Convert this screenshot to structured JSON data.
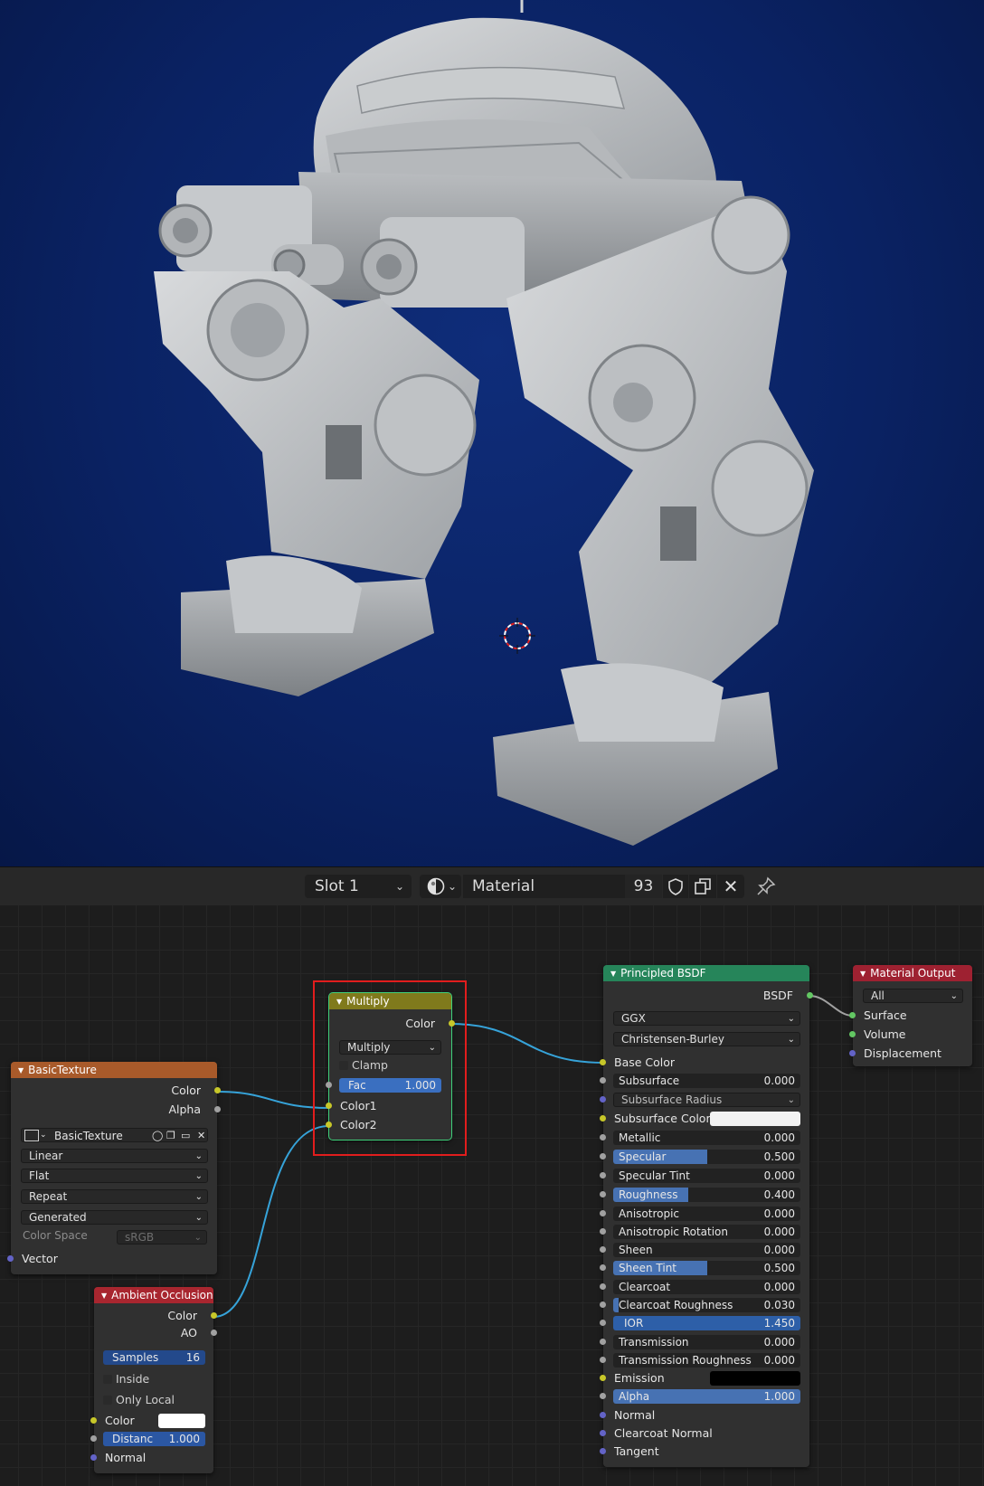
{
  "header": {
    "slot_label": "Slot 1",
    "material_name": "Material",
    "user_count": "93",
    "icons": [
      "sphere-shading-icon",
      "fake-user-shield-icon",
      "duplicate-icon",
      "close-icon",
      "pin-icon"
    ]
  },
  "nodes": {
    "basic_texture": {
      "title": "BasicTexture",
      "outputs": [
        "Color",
        "Alpha"
      ],
      "image_name": "BasicTexture",
      "interpolation": "Linear",
      "projection": "Flat",
      "extension": "Repeat",
      "source": "Generated",
      "color_space_label": "Color Space",
      "color_space_value": "sRGB",
      "input": "Vector"
    },
    "ambient_occlusion": {
      "title": "Ambient Occlusion",
      "outputs": [
        "Color",
        "AO"
      ],
      "samples_label": "Samples",
      "samples_value": "16",
      "inside_label": "Inside",
      "only_local_label": "Only Local",
      "color_label": "Color",
      "distance_label": "Distanc",
      "distance_value": "1.000",
      "normal_label": "Normal"
    },
    "multiply": {
      "title": "Multiply",
      "output": "Color",
      "blend_mode": "Multiply",
      "clamp_label": "Clamp",
      "fac_label": "Fac",
      "fac_value": "1.000",
      "input1": "Color1",
      "input2": "Color2"
    },
    "principled": {
      "title": "Principled BSDF",
      "output": "BSDF",
      "distribution": "GGX",
      "subsurface_method": "Christensen-Burley",
      "base_color_label": "Base Color",
      "subsurface_label": "Subsurface",
      "subsurface_value": "0.000",
      "subsurface_radius_label": "Subsurface Radius",
      "subsurface_color_label": "Subsurface Color",
      "metallic_label": "Metallic",
      "metallic_value": "0.000",
      "specular_label": "Specular",
      "specular_value": "0.500",
      "specular_fill": 0.5,
      "specular_tint_label": "Specular Tint",
      "specular_tint_value": "0.000",
      "roughness_label": "Roughness",
      "roughness_value": "0.400",
      "roughness_fill": 0.4,
      "anisotropic_label": "Anisotropic",
      "anisotropic_value": "0.000",
      "anisotropic_rotation_label": "Anisotropic Rotation",
      "anisotropic_rotation_value": "0.000",
      "sheen_label": "Sheen",
      "sheen_value": "0.000",
      "sheen_tint_label": "Sheen Tint",
      "sheen_tint_value": "0.500",
      "sheen_tint_fill": 0.5,
      "clearcoat_label": "Clearcoat",
      "clearcoat_value": "0.000",
      "clearcoat_roughness_label": "Clearcoat Roughness",
      "clearcoat_roughness_value": "0.030",
      "clearcoat_roughness_fill": 0.03,
      "ior_label": "IOR",
      "ior_value": "1.450",
      "transmission_label": "Transmission",
      "transmission_value": "0.000",
      "transmission_roughness_label": "Transmission Roughness",
      "transmission_roughness_value": "0.000",
      "emission_label": "Emission",
      "alpha_label": "Alpha",
      "alpha_value": "1.000",
      "alpha_fill": 1.0,
      "normal_label": "Normal",
      "clearcoat_normal_label": "Clearcoat Normal",
      "tangent_label": "Tangent"
    },
    "material_output": {
      "title": "Material Output",
      "target": "All",
      "inputs": [
        "Surface",
        "Volume",
        "Displacement"
      ]
    }
  },
  "colors": {
    "viewport_bg": "#0a2263",
    "texture_header": "#a85a2a",
    "ao_header": "#a8262f",
    "mix_header": "#807a1c",
    "bsdf_header": "#26855a",
    "output_header": "#9e2131",
    "selection_box": "#e11d1d",
    "link": "#36a3d9"
  }
}
